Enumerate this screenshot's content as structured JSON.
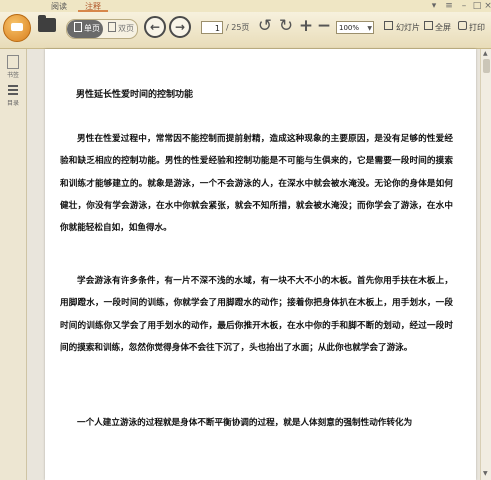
{
  "tabs": [
    {
      "label": "阅读",
      "active": false
    },
    {
      "label": "注释",
      "active": true
    }
  ],
  "toolbar": {
    "single_page_label": "单页",
    "double_page_label": "双页",
    "back_icon": "arrow-left-icon",
    "forward_icon": "arrow-right-icon",
    "current_page": "1",
    "total_pages": "/ 25页",
    "zoom_value": "100%",
    "slideshow_label": "幻灯片",
    "fullscreen_label": "全屏",
    "print_label": "打印"
  },
  "sidebar": {
    "items": [
      {
        "label": "书签",
        "icon": "bookmark-icon"
      },
      {
        "label": "目录",
        "icon": "toc-icon"
      }
    ]
  },
  "document": {
    "title": "男性延长性爱时间的控制功能",
    "paragraphs": [
      "男性在性爱过程中，常常因不能控制而提前射精，造成这种现象的主要原因，是没有足够的性爱经验和缺乏相应的控制功能。男性的性爱经验和控制功能是不可能与生俱来的，它是需要一段时间的摸索和训练才能够建立的。就象是游泳，一个不会游泳的人，在深水中就会被水淹没。无论你的身体是如何健壮，你没有学会游泳，在水中你就会紧张，就会不知所措，就会被水淹没；而你学会了游泳，在水中你就能轻松自如，如鱼得水。",
      "学会游泳有许多条件，有一片不深不浅的水域，有一块不大不小的木板。首先你用手扶在木板上，用脚蹬水，一段时间的训练，你就学会了用脚蹬水的动作；接着你把身体扒在木板上，用手划水，一段时间的训练你又学会了用手划水的动作，最后你推开木板，在水中你的手和脚不断的划动，经过一段时间的摸索和训练，忽然你觉得身体不会往下沉了，头也抬出了水面；从此你也就学会了游泳。",
      "一个人建立游泳的过程就是身体不断平衡协调的过程，就是人体刻意的强制性动作转化为"
    ]
  },
  "colors": {
    "accent": "#d7874b",
    "toolbar_bg": "#efe6c4",
    "page_bg": "#ffffff"
  }
}
